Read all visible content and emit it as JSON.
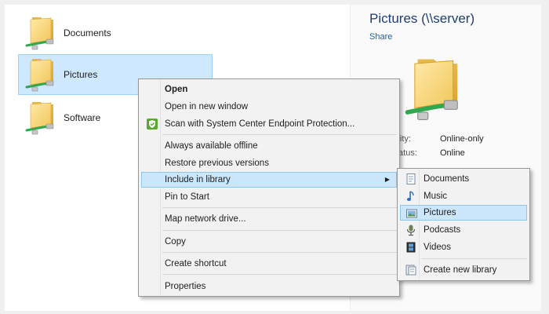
{
  "files": [
    {
      "label": "Documents"
    },
    {
      "label": "Pictures"
    },
    {
      "label": "Software"
    }
  ],
  "details": {
    "title": "Pictures (\\\\server)",
    "subtitle": "Share",
    "properties": [
      {
        "label": "ility:",
        "value": "Online-only"
      },
      {
        "label": "tatus:",
        "value": "Online"
      }
    ]
  },
  "context_menu": {
    "items": [
      {
        "label": "Open",
        "bold": true
      },
      {
        "label": "Open in new window"
      },
      {
        "label": "Scan with System Center Endpoint Protection...",
        "icon": "shield-icon"
      },
      {
        "label": "Always available offline"
      },
      {
        "label": "Restore previous versions"
      },
      {
        "label": "Include in library",
        "submenu": true,
        "highlighted": true
      },
      {
        "label": "Pin to Start"
      },
      {
        "label": "Map network drive..."
      },
      {
        "label": "Copy"
      },
      {
        "label": "Create shortcut"
      },
      {
        "label": "Properties"
      }
    ]
  },
  "submenu": {
    "items": [
      {
        "label": "Documents",
        "icon": "documents-library-icon"
      },
      {
        "label": "Music",
        "icon": "music-note-icon"
      },
      {
        "label": "Pictures",
        "icon": "pictures-library-icon",
        "highlighted": true
      },
      {
        "label": "Podcasts",
        "icon": "podcast-microphone-icon"
      },
      {
        "label": "Videos",
        "icon": "film-strip-icon"
      },
      {
        "label": "Create new library",
        "icon": "new-library-icon"
      }
    ]
  },
  "colors": {
    "selection": "#cde8ff",
    "selection_border": "#99d1ff",
    "menu_highlight": "#cce6fb",
    "folder": "#f3c95a",
    "network_cable": "#2fa84f"
  }
}
